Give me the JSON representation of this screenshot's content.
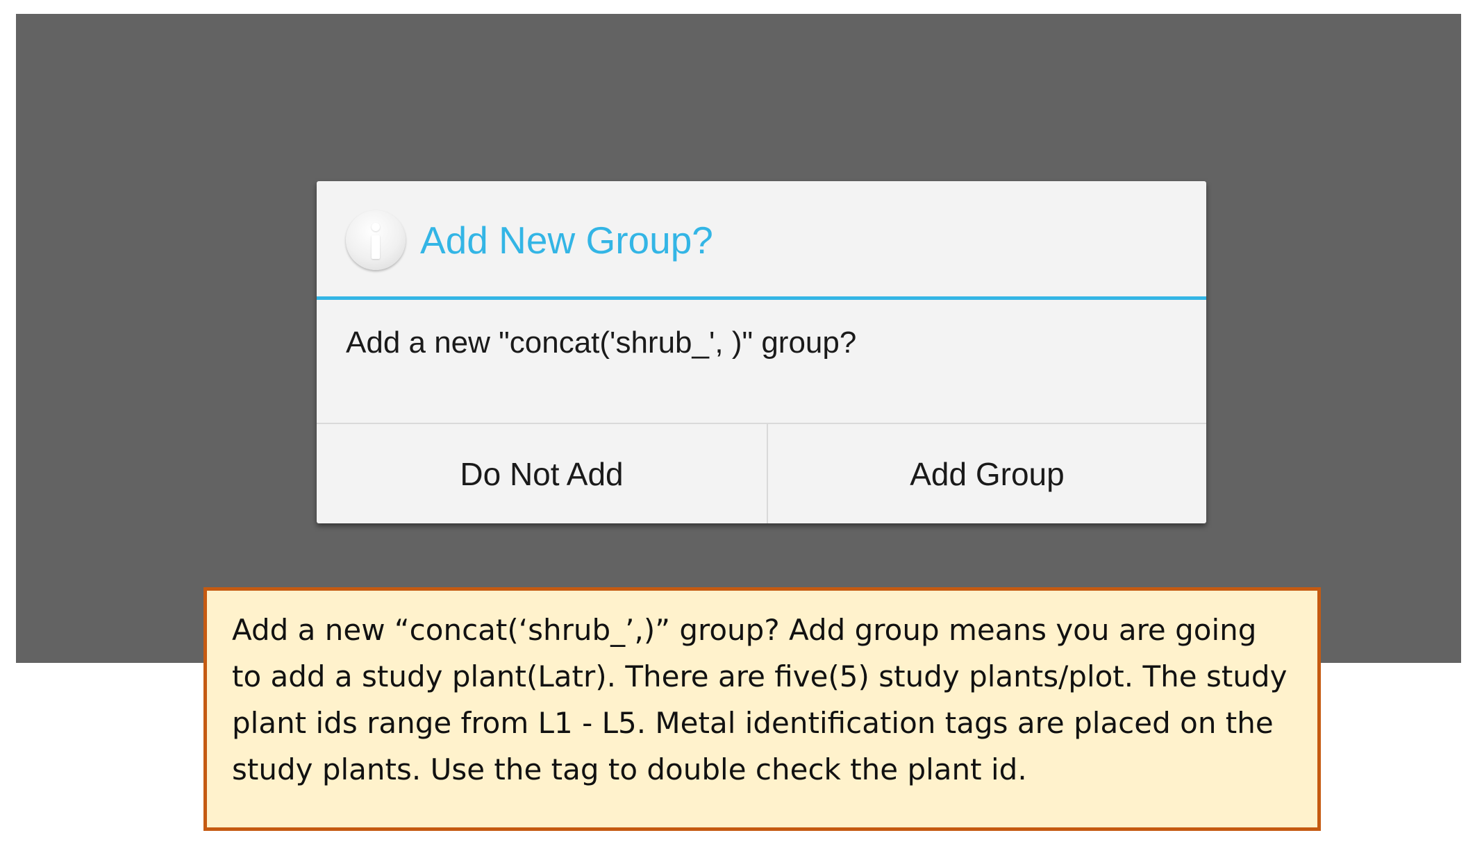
{
  "dialog": {
    "icon": "info-icon",
    "title": "Add New Group?",
    "message": "Add a new \"concat('shrub_', )\" group?",
    "accent_color": "#33b5e5",
    "buttons": {
      "negative": "Do Not Add",
      "positive": "Add Group"
    }
  },
  "note": {
    "lines": [
      "Add a new “concat(‘shrub_’,)” group?  Add group means you are going",
      "to add a study plant(Latr).  There are five(5) study plants/plot.  The study",
      "plant ids range from L1 - L5.  Metal identification tags are placed on the",
      "study plants.  Use the tag to double check the plant id."
    ],
    "border_color": "#c55a11",
    "background_color": "#fff2cc"
  }
}
